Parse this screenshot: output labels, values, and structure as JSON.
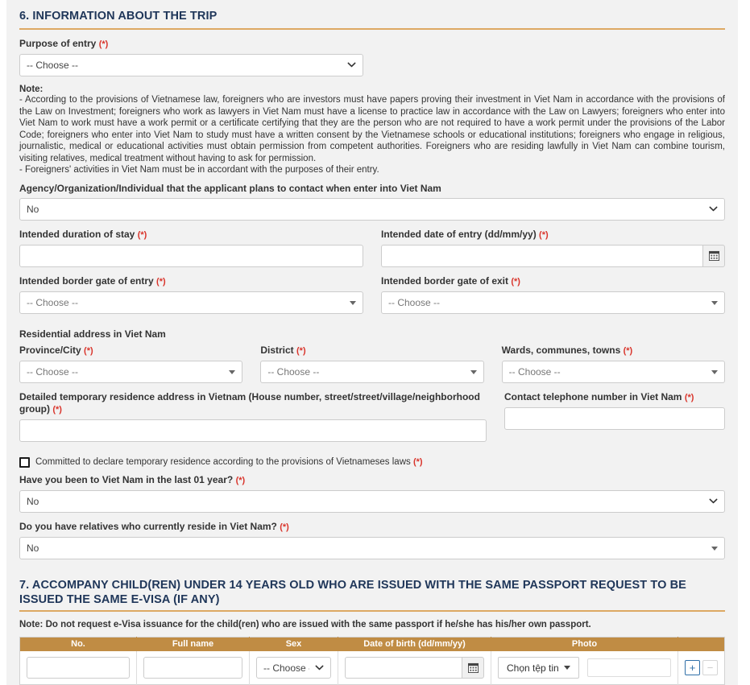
{
  "section6": {
    "heading": "6. INFORMATION ABOUT THE TRIP",
    "purpose": {
      "label": "Purpose of entry",
      "required_mark": "(*)",
      "value": "-- Choose --"
    },
    "note": {
      "heading": "Note:",
      "paragraph1": "- According to the provisions of Vietnamese law, foreigners who are investors must have papers proving their investment in Viet Nam in accordance with the provisions of the Law on Investment; foreigners who work as lawyers in Viet Nam must have a license to practice law in accordance with the Law on Lawyers; foreigners who enter into Viet Nam to work must have a work permit or a certificate certifying that they are the person who are not required to have a work permit under the provisions of the Labor Code; foreigners who enter into Viet Nam to study must have a written consent by the Vietnamese schools or educational institutions; foreigners who engage in religious, journalistic, medical or educational activities must obtain permission from competent authorities. Foreigners who are residing lawfully in Viet Nam can combine tourism, visiting relatives, medical treatment without having to ask for permission.",
      "paragraph2": "- Foreigners' activities in Viet Nam must be in accordant with the purposes of their entry."
    },
    "agency": {
      "label": "Agency/Organization/Individual that the applicant plans to contact when enter into Viet Nam",
      "value": "No"
    },
    "duration": {
      "label": "Intended duration of stay",
      "required_mark": "(*)",
      "value": "",
      "placeholder": ""
    },
    "entry_date": {
      "label": "Intended date of entry (dd/mm/yy)",
      "required_mark": "(*)",
      "value": "",
      "placeholder": "",
      "icon": "calendar-icon"
    },
    "border_entry": {
      "label": "Intended border gate of entry",
      "required_mark": "(*)",
      "value": "-- Choose --"
    },
    "border_exit": {
      "label": "Intended border gate of exit",
      "required_mark": "(*)",
      "value": "-- Choose --"
    },
    "residential_heading": "Residential address in Viet Nam",
    "province": {
      "label": "Province/City",
      "required_mark": "(*)",
      "value": "-- Choose --"
    },
    "district": {
      "label": "District",
      "required_mark": "(*)",
      "value": "-- Choose --"
    },
    "ward": {
      "label": "Wards, communes, towns",
      "required_mark": "(*)",
      "value": "-- Choose --"
    },
    "detailed_address": {
      "label": "Detailed temporary residence address in Vietnam (House number, street/street/village/neighborhood group)",
      "required_mark": "(*)",
      "value": "",
      "placeholder": ""
    },
    "phone": {
      "label": "Contact telephone number in Viet Nam",
      "required_mark": "(*)",
      "value": "",
      "placeholder": ""
    },
    "commit_checkbox": {
      "label": "Committed to declare temporary residence according to the provisions of Vietnameses laws",
      "required_mark": "(*)",
      "checked": false
    },
    "been_before": {
      "label": "Have you been to Viet Nam in the last 01 year?",
      "required_mark": "(*)",
      "value": "No"
    },
    "relatives": {
      "label": "Do you have relatives who currently reside in Viet Nam?",
      "required_mark": "(*)",
      "value": "No"
    }
  },
  "section7": {
    "heading": "7. ACCOMPANY CHILD(REN) UNDER 14 YEARS OLD WHO ARE ISSUED WITH THE SAME PASSPORT REQUEST TO BE ISSUED THE SAME E-VISA (IF ANY)",
    "note": "Note: Do not request e-Visa issuance for the child(ren) who are issued with the same passport if he/she has his/her own passport.",
    "table": {
      "columns": [
        "No.",
        "Full name",
        "Sex",
        "Date of birth (dd/mm/yy)",
        "Photo"
      ],
      "rows": [
        {
          "no": "",
          "full_name": "",
          "sex": "-- Choose --",
          "dob": "",
          "file_button": "Chọn tệp tin",
          "file_name": "",
          "add_label": "+",
          "remove_label": "−"
        }
      ]
    }
  },
  "colors": {
    "accent_rule": "#dda963",
    "table_header": "#c08c44",
    "heading": "#1f3659",
    "required": "#d9342b",
    "panel_bg": "#f2f2f2",
    "add_button_border": "#2f6fa8"
  }
}
